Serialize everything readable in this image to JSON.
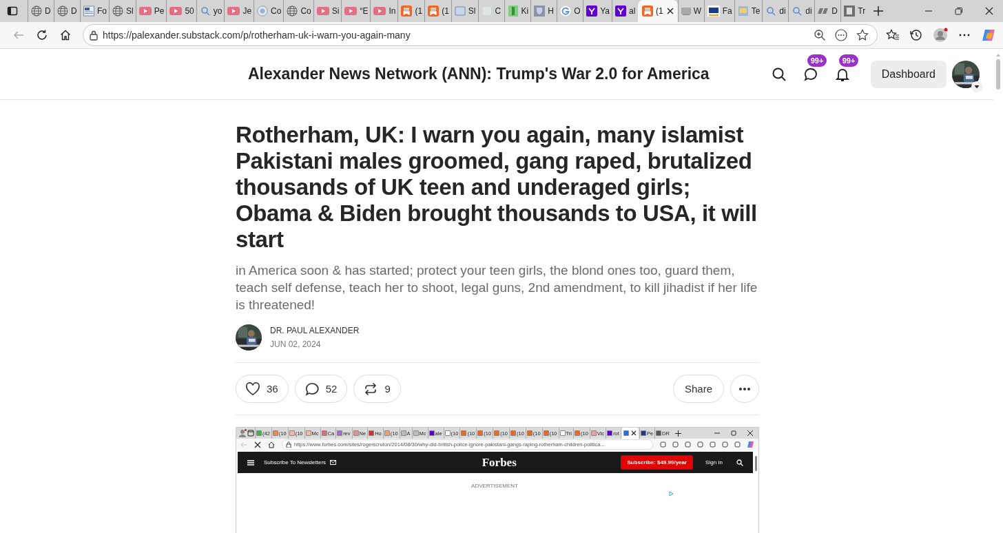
{
  "browser": {
    "tabs": [
      {
        "kind": "globe",
        "label": "D",
        "selected": false
      },
      {
        "kind": "globe",
        "label": "D",
        "selected": false
      },
      {
        "kind": "news",
        "label": "Fo",
        "selected": false
      },
      {
        "kind": "globe",
        "label": "Sl",
        "selected": false
      },
      {
        "kind": "youtube",
        "label": "Pe",
        "selected": false
      },
      {
        "kind": "youtube",
        "label": "50",
        "selected": false
      },
      {
        "kind": "search",
        "label": "yo",
        "selected": false
      },
      {
        "kind": "youtube",
        "label": "Je",
        "selected": false
      },
      {
        "kind": "seal",
        "label": "Co",
        "selected": false
      },
      {
        "kind": "globe",
        "label": "Co",
        "selected": false
      },
      {
        "kind": "youtube",
        "label": "Si",
        "selected": false
      },
      {
        "kind": "youtube",
        "label": "“E",
        "selected": false
      },
      {
        "kind": "youtube",
        "label": "In",
        "selected": false
      },
      {
        "kind": "substack",
        "label": "(1",
        "selected": false
      },
      {
        "kind": "substack",
        "label": "(1",
        "selected": false
      },
      {
        "kind": "medium",
        "label": "Sl",
        "selected": false
      },
      {
        "kind": "blank",
        "label": "C",
        "selected": false
      },
      {
        "kind": "green",
        "label": "Ki",
        "selected": false
      },
      {
        "kind": "shield",
        "label": "H",
        "selected": false
      },
      {
        "kind": "google",
        "label": "O",
        "selected": false
      },
      {
        "kind": "yahoo",
        "label": "Ya",
        "selected": false
      },
      {
        "kind": "yahoo",
        "label": "al",
        "selected": false
      },
      {
        "kind": "substack",
        "label": "(1",
        "selected": true
      },
      {
        "kind": "fp",
        "label": "W",
        "selected": false
      },
      {
        "kind": "gp",
        "label": "Fa",
        "selected": false
      },
      {
        "kind": "mag",
        "label": "Te",
        "selected": false
      },
      {
        "kind": "search",
        "label": "di",
        "selected": false
      },
      {
        "kind": "search",
        "label": "di",
        "selected": false
      },
      {
        "kind": "dr",
        "label": "D",
        "selected": false
      },
      {
        "kind": "f",
        "label": "Tr",
        "selected": false
      }
    ],
    "url": "https://palexander.substack.com/p/rotherham-uk-i-warn-you-again-many"
  },
  "header": {
    "publication": "Alexander News Network (ANN): Trump's War 2.0 for America",
    "chat_badge": "99+",
    "notification_badge": "99+",
    "dashboard": "Dashboard"
  },
  "post": {
    "title": "Rotherham, UK: I warn you again, many islamist Pakistani males groomed, gang raped, brutalized thousands of UK teen and underaged girls; Obama & Biden brought thousands to USA, it will start",
    "subtitle": "in America soon & has started; protect your teen girls, the blond ones too, guard them, teach self defense, teach her to shoot, legal guns, 2nd amendment, to kill jihadist if her life is threatened!",
    "author": "DR. PAUL ALEXANDER",
    "date": "JUN 02, 2024",
    "actions": [
      {
        "kind": "like",
        "count": "36"
      },
      {
        "kind": "comment",
        "count": "52"
      },
      {
        "kind": "restack",
        "count": "9"
      }
    ],
    "share": "Share"
  },
  "screenshot": {
    "tabs": [
      {
        "label": "(42",
        "color": "#3cb44b",
        "selected": false
      },
      {
        "label": "(10",
        "color": "#f08a4b",
        "selected": false
      },
      {
        "label": "(10",
        "color": "#f2b8a8",
        "selected": false
      },
      {
        "label": "Mc",
        "color": "#f2b8a8",
        "selected": false
      },
      {
        "label": "Ca",
        "color": "#e06c80",
        "selected": false
      },
      {
        "label": "rev",
        "color": "#a070d0",
        "selected": false
      },
      {
        "label": "Ne",
        "color": "#e8908a",
        "selected": false
      },
      {
        "label": "Ho",
        "color": "#d03030",
        "selected": false
      },
      {
        "label": "(10",
        "color": "#f0a070",
        "selected": false
      },
      {
        "label": "A",
        "color": "#bbbbbb",
        "selected": false
      },
      {
        "label": "Mc",
        "color": "#bbbbbb",
        "selected": false
      },
      {
        "label": "ale",
        "color": "#6001d2",
        "selected": false
      },
      {
        "label": "(10",
        "color": "#ffffff",
        "selected": false
      },
      {
        "label": "(10",
        "color": "#f26522",
        "selected": false
      },
      {
        "label": "(10",
        "color": "#f26522",
        "selected": false
      },
      {
        "label": "(10",
        "color": "#f26522",
        "selected": false
      },
      {
        "label": "(10",
        "color": "#f26522",
        "selected": false
      },
      {
        "label": "(10",
        "color": "#f26522",
        "selected": false
      },
      {
        "label": "(10",
        "color": "#f26522",
        "selected": false
      },
      {
        "label": "Tri",
        "color": "#ffffff",
        "selected": false
      },
      {
        "label": "(10",
        "color": "#f26522",
        "selected": false
      },
      {
        "label": "Vic",
        "color": "#e8a0a0",
        "selected": false
      },
      {
        "label": "rot",
        "color": "#6001d2",
        "selected": false
      },
      {
        "color": "#1a73e8",
        "selected": true
      },
      {
        "label": "Pe",
        "color": "#1a3a8a",
        "selected": false
      },
      {
        "label": "DR",
        "color": "#555555",
        "selected": false
      }
    ],
    "url": "https://www.forbes.com/sites/rogerscruton/2014/08/30/why-did-british-police-ignore-pakistani-gangs-raping-rotherham-children-politica...",
    "newsletters": "Subscribe To Newsletters",
    "logo": "Forbes",
    "subscribe": "Subscribe: $49.99/year",
    "sign_in": "Sign In",
    "ad_label": "ADVERTISEMENT"
  }
}
